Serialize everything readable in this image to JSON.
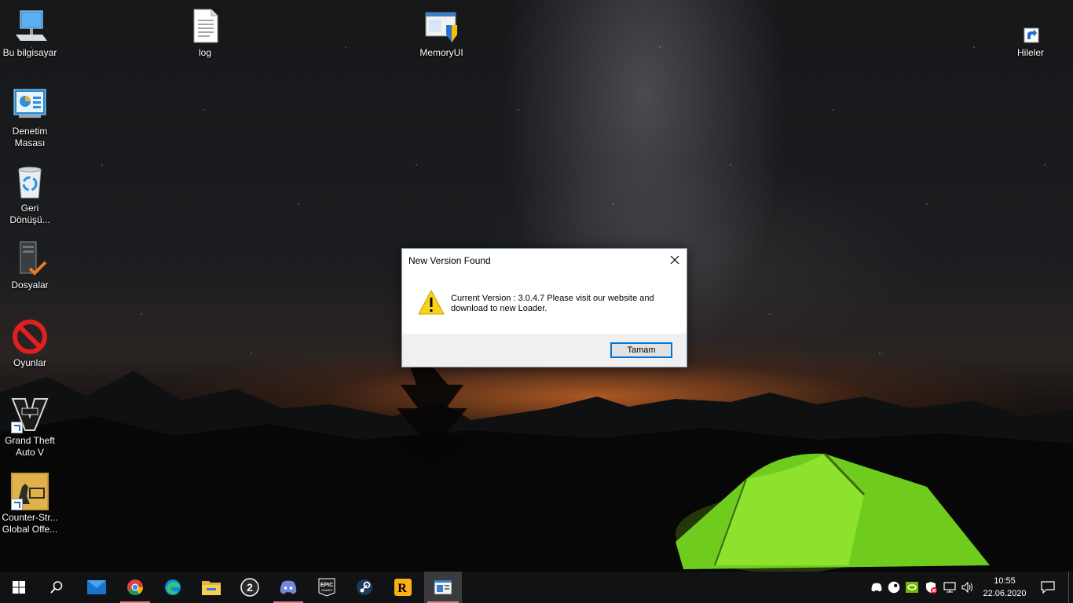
{
  "desktop": {
    "icons": [
      {
        "label": "Bu bilgisayar",
        "icon": "computer-icon"
      },
      {
        "label": "log",
        "icon": "text-file-icon"
      },
      {
        "label": "MemoryUI",
        "icon": "app-window-icon"
      },
      {
        "label": "Hileler",
        "icon": "shortcut-icon"
      },
      {
        "label": "Denetim Masası",
        "icon": "control-panel-icon"
      },
      {
        "label": "Geri Dönüşü...",
        "icon": "recycle-bin-icon"
      },
      {
        "label": "Dosyalar",
        "icon": "server-folder-icon"
      },
      {
        "label": "Oyunlar",
        "icon": "prohibited-icon"
      },
      {
        "label": "Grand Theft Auto V",
        "icon": "gta5-icon"
      },
      {
        "label": "Counter-Str... Global Offe...",
        "icon": "csgo-icon"
      }
    ]
  },
  "dialog": {
    "title": "New Version Found",
    "message": "Current Version : 3.0.4.7 Please visit our website and download to new Loader.",
    "ok_label": "Tamam",
    "icon": "warning-icon"
  },
  "taskbar": {
    "apps": [
      {
        "name": "start",
        "icon": "windows-start-icon"
      },
      {
        "name": "search",
        "icon": "search-icon"
      },
      {
        "name": "mail",
        "icon": "mail-icon"
      },
      {
        "name": "chrome",
        "icon": "chrome-icon"
      },
      {
        "name": "edge",
        "icon": "edge-icon"
      },
      {
        "name": "file-explorer",
        "icon": "folder-icon"
      },
      {
        "name": "app-2",
        "icon": "number-two-icon"
      },
      {
        "name": "discord",
        "icon": "discord-icon"
      },
      {
        "name": "epic-games",
        "icon": "epic-games-icon"
      },
      {
        "name": "steam",
        "icon": "steam-icon"
      },
      {
        "name": "rockstar",
        "icon": "rockstar-icon"
      },
      {
        "name": "memoryui",
        "icon": "app-window-icon"
      }
    ],
    "epic_text": "EPIC",
    "epic_sub": "GAMES",
    "two_text": "2",
    "rockstar_text": "R",
    "clock": {
      "time": "10:55",
      "date": "22.06.2020"
    },
    "colors": {
      "accent": "#0078d7",
      "running_underline": "#e07e88"
    }
  }
}
